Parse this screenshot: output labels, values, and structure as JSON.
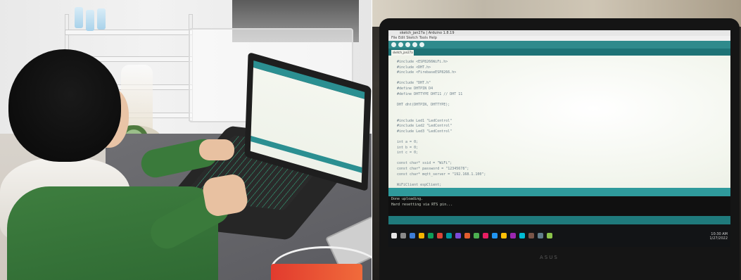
{
  "ide": {
    "window_title": "sketch_jan27a | Arduino 1.8.19",
    "menu": "File Edit Sketch Tools Help",
    "tab_label": "sketch_jan27a",
    "code_lines": [
      "#include <ESP8266WiFi.h>",
      "#include <DHT.h>",
      "#include <FirebaseESP8266.h>",
      "",
      "#include \"DHT.h\"",
      "#define DHTPIN D4",
      "#define DHTTYPE DHT11 // DHT 11",
      "",
      "DHT dht(DHTPIN, DHTTYPE);",
      "",
      "",
      "#include Led1 \"LedControl\"",
      "#include Led2 \"LedControl\"",
      "#include Led3 \"LedControl\"",
      "",
      "int a = 0;",
      "int b = 0;",
      "int c = 0;",
      "",
      "const char* ssid = \"WiFi\";",
      "const char* password = \"12345678\";",
      "const char* mqtt_server = \"192.168.1.100\";",
      "",
      "WiFiClient espClient;"
    ],
    "console_lines": [
      "Done uploading.",
      "Hard resetting via RTS pin..."
    ],
    "tray_time": "10:30 AM",
    "tray_date": "1/27/2022"
  },
  "laptop_brand": "ASUS",
  "colors": {
    "ide_teal": "#2f8a8c",
    "ide_dark_teal": "#1e7376",
    "sweater_green": "#3e7e3f"
  }
}
